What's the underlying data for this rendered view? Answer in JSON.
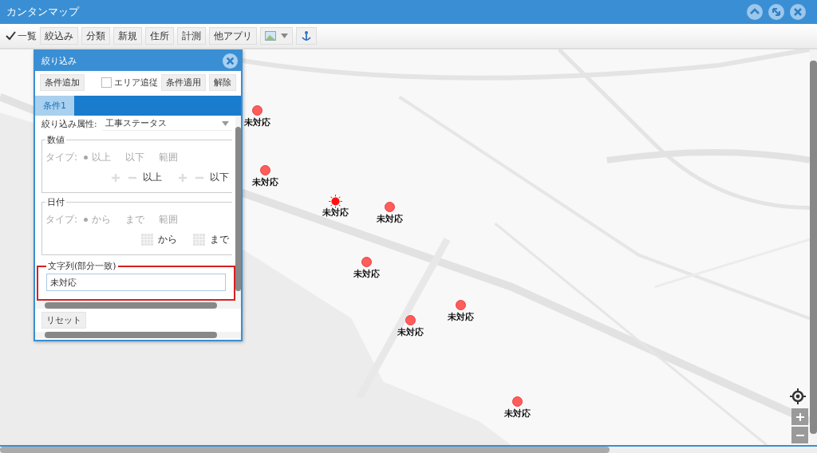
{
  "window": {
    "title": "カンタンマップ"
  },
  "toolbar": {
    "list_toggle": {
      "label": "一覧",
      "checked": true
    },
    "buttons": [
      "絞込み",
      "分類",
      "新規",
      "住所",
      "計測",
      "他アプリ"
    ]
  },
  "filter_panel": {
    "title": "絞り込み",
    "add_button": "条件追加",
    "area_follow": {
      "label": "エリア追従",
      "checked": false
    },
    "apply_button": "条件適用",
    "clear_button": "解除",
    "tabs": [
      {
        "label": "条件1",
        "selected": true
      }
    ],
    "attribute": {
      "label": "絞り込み属性:",
      "value": "工事ステータス"
    },
    "sections": [
      {
        "kind": "number",
        "title": "数値",
        "disabled": true,
        "type_label": "タイプ:",
        "options": [
          {
            "label": "以上",
            "selected": true
          },
          {
            "label": "以下",
            "selected": false
          },
          {
            "label": "範囲",
            "selected": false
          }
        ],
        "fields": [
          "以上",
          "以下"
        ]
      },
      {
        "kind": "date",
        "title": "日付",
        "disabled": true,
        "type_label": "タイプ:",
        "options": [
          {
            "label": "から",
            "selected": true
          },
          {
            "label": "まで",
            "selected": false
          },
          {
            "label": "範囲",
            "selected": false
          }
        ],
        "fields": [
          "から",
          "まで"
        ]
      },
      {
        "kind": "text",
        "title": "文字列(部分一致)",
        "value": "未対応",
        "highlighted": true
      }
    ],
    "reset_button": "リセット"
  },
  "markers": [
    {
      "label": "未対応",
      "selected": false
    },
    {
      "label": "未対応",
      "selected": false
    },
    {
      "label": "未対応",
      "selected": true
    },
    {
      "label": "未対応",
      "selected": false
    },
    {
      "label": "未対応",
      "selected": false
    },
    {
      "label": "未対応",
      "selected": false
    },
    {
      "label": "未対応",
      "selected": false
    },
    {
      "label": "未対応",
      "selected": false
    }
  ]
}
